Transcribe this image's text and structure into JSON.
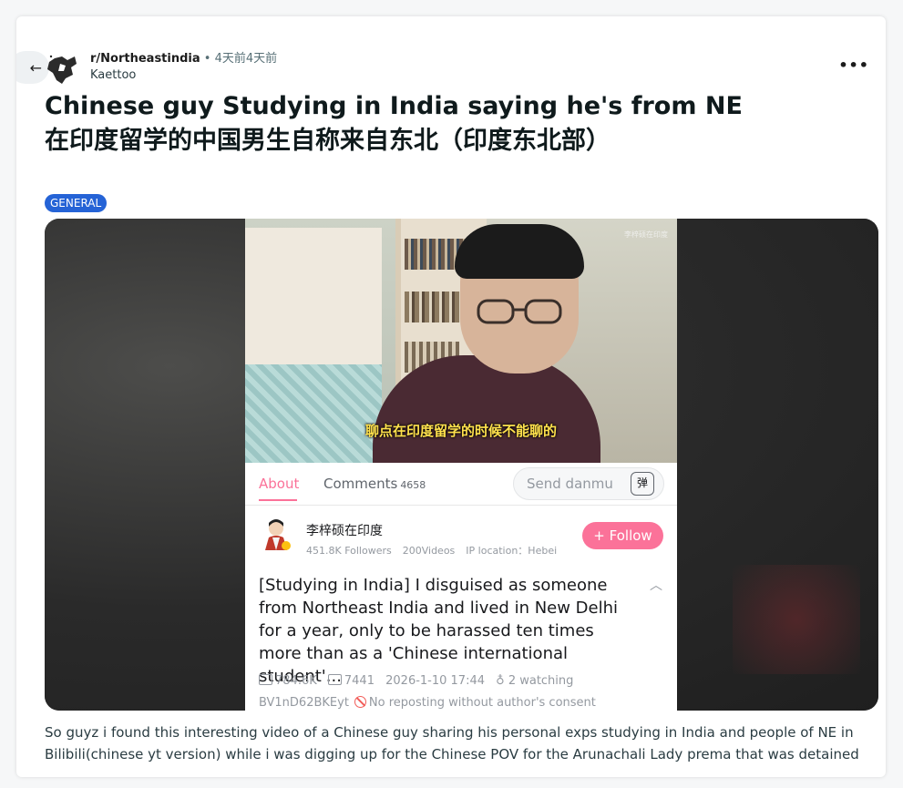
{
  "post": {
    "subreddit": "r/Northeastindia",
    "separator": "•",
    "time": "4天前4天前",
    "author": "Kaettoo",
    "title_en": "Chinese guy Studying in India saying he's from NE",
    "title_zh": "在印度留学的中国男生自称来自东北（印度东北部）",
    "flair": "GENERAL",
    "more_label": "•••",
    "body": "So guyz i found this interesting video of a Chinese guy sharing his personal exps studying in India and people of NE in Bilibili(chinese yt version) while i was digging up for the Chinese POV for the Arunachali Lady prema that was detained"
  },
  "embed": {
    "subtitle": "聊点在印度留学的时候不能聊的",
    "watermark": "李梓硕在印度",
    "tab_about": "About",
    "tab_comments": "Comments",
    "comments_count": "4658",
    "danmu_placeholder": "Send danmu",
    "danmu_icon_char": "弹",
    "uploader_name": "李梓硕在印度",
    "followers": "451.8K Followers",
    "videos": "200Videos",
    "ip_location": "IP location：Hebei",
    "follow_label": "+ Follow",
    "description": "[Studying in India] I disguised as someone from Northeast India and lived in New Delhi for a year, only to be harassed ten times more than as a 'Chinese international student'...",
    "views": "784.6K",
    "danmaku_count": "7441",
    "date": "2026-1-10 17:44",
    "watching": "2 watching",
    "bvid": "BV1nD62BKEyt",
    "repost_notice": "No reposting without author's consent"
  },
  "colors": {
    "accent_pink": "#fb7299",
    "flair_blue": "#2563d6",
    "subtitle_yellow": "#ffe14d"
  }
}
